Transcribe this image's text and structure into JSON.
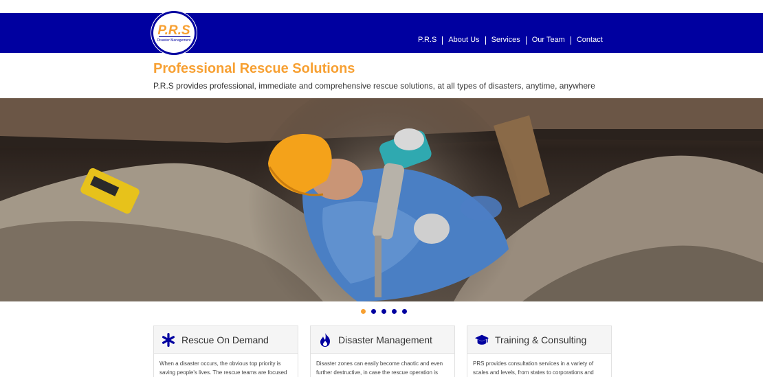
{
  "logo": {
    "text": "P.R.S",
    "subtext": "Disaster Management"
  },
  "nav": {
    "items": [
      {
        "label": "P.R.S"
      },
      {
        "label": "About Us"
      },
      {
        "label": "Services"
      },
      {
        "label": "Our Team"
      },
      {
        "label": "Contact"
      }
    ]
  },
  "hero": {
    "title": "Professional Rescue Solutions",
    "subtitle": "P.R.S provides professional, immediate and comprehensive rescue solutions, at all types of disasters, anytime, anywhere"
  },
  "carousel": {
    "slide_count": 5,
    "active_index": 0
  },
  "cards": [
    {
      "title": "Rescue On Demand",
      "icon": "asterisk-icon",
      "text": "When a disaster occurs, the obvious top priority is saving people's lives. The rescue teams are focused"
    },
    {
      "title": "Disaster Management",
      "icon": "fire-icon",
      "text": "Disaster zones can easily become chaotic and even further destructive, in case the rescue operation is"
    },
    {
      "title": "Training & Consulting",
      "icon": "graduation-cap-icon",
      "text": "PRS provides consultation services in a variety of scales and levels, from states to corporations and"
    }
  ],
  "colors": {
    "brand_blue": "#0000a0",
    "accent_orange": "#f7a032"
  }
}
